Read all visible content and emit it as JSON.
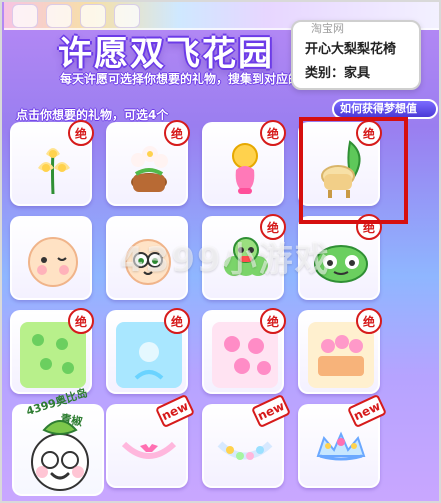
{
  "header": {
    "title": "许愿双飞花园",
    "subtitle": "每天许愿可选择你想要的礼物，搜集到对应的梦想值花朵",
    "howto_label": "如何获得梦想值",
    "pick_hint": "点击你想要的礼物，可选4个"
  },
  "tooltip": {
    "ghost_text": "淘宝网",
    "name": "开心大梨梨花椅",
    "category": "类别：家具"
  },
  "watermark": "4399小游戏",
  "avatar_card": {
    "left_text": "4399奥比岛",
    "right_text": "青椒"
  },
  "badges": {
    "exclusive": "绝",
    "new": "new"
  },
  "items": [
    {
      "row": 0,
      "col": 0,
      "label": "lily-plant",
      "badge": "exclusive"
    },
    {
      "row": 0,
      "col": 1,
      "label": "flower-pot",
      "badge": "exclusive"
    },
    {
      "row": 0,
      "col": 2,
      "label": "golden-lamp",
      "badge": "exclusive"
    },
    {
      "row": 0,
      "col": 3,
      "label": "pear-leaf-chair",
      "badge": "exclusive",
      "selected": true
    },
    {
      "row": 1,
      "col": 0,
      "label": "baby-face",
      "badge": ""
    },
    {
      "row": 1,
      "col": 1,
      "label": "cute-bug",
      "badge": ""
    },
    {
      "row": 1,
      "col": 2,
      "label": "green-caterpillar",
      "badge": "exclusive"
    },
    {
      "row": 1,
      "col": 3,
      "label": "green-monster",
      "badge": "exclusive"
    },
    {
      "row": 2,
      "col": 0,
      "label": "clover-background",
      "badge": "exclusive"
    },
    {
      "row": 2,
      "col": 1,
      "label": "fairy-background",
      "badge": "exclusive"
    },
    {
      "row": 2,
      "col": 2,
      "label": "pink-flowers",
      "badge": "exclusive"
    },
    {
      "row": 2,
      "col": 3,
      "label": "flower-shop",
      "badge": "exclusive"
    },
    {
      "row": 3,
      "col": 1,
      "label": "bow-necklace",
      "badge": "new"
    },
    {
      "row": 3,
      "col": 2,
      "label": "pastel-necklace",
      "badge": "new"
    },
    {
      "row": 3,
      "col": 3,
      "label": "jewel-crown",
      "badge": "new"
    }
  ]
}
